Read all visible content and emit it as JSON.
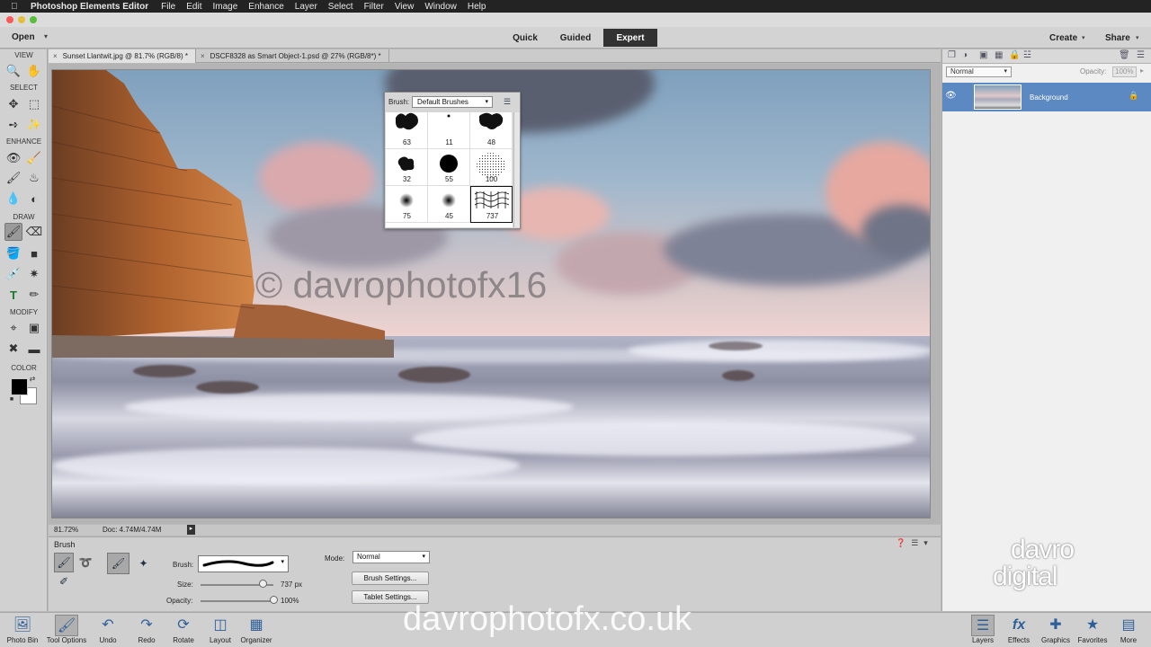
{
  "menubar": {
    "app_name": "Photoshop Elements Editor",
    "items": [
      "File",
      "Edit",
      "Image",
      "Enhance",
      "Layer",
      "Select",
      "Filter",
      "View",
      "Window",
      "Help"
    ]
  },
  "appbar": {
    "open_label": "Open",
    "modes": [
      "Quick",
      "Guided",
      "Expert"
    ],
    "active_mode": "Expert",
    "create_label": "Create",
    "share_label": "Share"
  },
  "toolbox": {
    "sections": [
      "VIEW",
      "SELECT",
      "ENHANCE",
      "DRAW",
      "MODIFY",
      "COLOR"
    ]
  },
  "tabs": [
    {
      "label": "Sunset Llantwit.jpg @ 81.7% (RGB/8) *",
      "active": true
    },
    {
      "label": "DSCF8328 as Smart Object-1.psd @ 27% (RGB/8*) *",
      "active": false
    }
  ],
  "canvas": {
    "watermark": "© davrophotofx16"
  },
  "brush_picker": {
    "label": "Brush:",
    "set": "Default Brushes",
    "sizes": [
      "63",
      "11",
      "48",
      "32",
      "55",
      "100",
      "75",
      "45",
      "737"
    ],
    "selected_size": "737"
  },
  "statusbar": {
    "zoom": "81.72%",
    "doc": "Doc: 4.74M/4.74M"
  },
  "tool_options": {
    "title": "Brush",
    "brush_label": "Brush:",
    "size_label": "Size:",
    "size_value": "737 px",
    "size_level": 0.85,
    "opacity_label": "Opacity:",
    "opacity_value": "100%",
    "opacity_level": 1.0,
    "mode_label": "Mode:",
    "mode_value": "Normal",
    "brush_settings": "Brush Settings...",
    "tablet_settings": "Tablet Settings..."
  },
  "layers_panel": {
    "blend_mode": "Normal",
    "opacity_label": "Opacity:",
    "opacity_value": "100%",
    "layer_name": "Background"
  },
  "logo": {
    "line1": "davro",
    "line2": "digital"
  },
  "taskbar": {
    "left": [
      {
        "label": "Photo Bin",
        "icon": "photo-bin-icon"
      },
      {
        "label": "Tool Options",
        "icon": "tool-options-icon"
      },
      {
        "label": "Undo",
        "icon": "undo-icon"
      },
      {
        "label": "Redo",
        "icon": "redo-icon"
      },
      {
        "label": "Rotate",
        "icon": "rotate-icon"
      },
      {
        "label": "Layout",
        "icon": "layout-icon"
      },
      {
        "label": "Organizer",
        "icon": "organizer-icon"
      }
    ],
    "right": [
      {
        "label": "Layers",
        "icon": "layers-icon"
      },
      {
        "label": "Effects",
        "icon": "effects-icon"
      },
      {
        "label": "Graphics",
        "icon": "graphics-icon"
      },
      {
        "label": "Favorites",
        "icon": "favorites-icon"
      },
      {
        "label": "More",
        "icon": "more-icon"
      }
    ]
  },
  "footer_watermark": "davrophotofx.co.uk",
  "colors": {
    "accent": "#5c89c1",
    "foreground": "#000000",
    "background": "#ffffff"
  }
}
